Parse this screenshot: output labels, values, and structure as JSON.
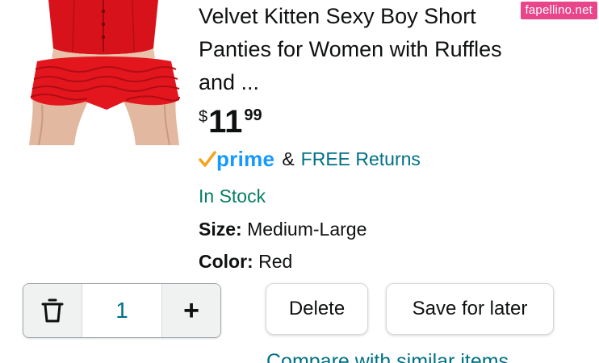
{
  "product": {
    "title_line1": "Velvet Kitten Sexy Boy Short",
    "title_line2": "Panties for Women with Ruffles",
    "title_line3": "and ...",
    "price": {
      "currency": "$",
      "whole": "11",
      "fraction": "99"
    },
    "prime_label": "prime",
    "ampersand": "&",
    "free_returns": "FREE Returns",
    "stock_status": "In Stock",
    "size_label": "Size:",
    "size_value": "Medium-Large",
    "color_label": "Color:",
    "color_value": "Red"
  },
  "cart_controls": {
    "quantity": "1",
    "delete_label": "Delete",
    "save_for_later_label": "Save for later",
    "compare_label": "Compare with similar items",
    "icons": {
      "trash": "trash-icon",
      "plus": "plus-icon"
    }
  },
  "watermark": "fapellino.net",
  "colors": {
    "link_teal": "#007185",
    "stock_green": "#067d62",
    "prime_blue": "#1399ff",
    "prime_orange": "#f7a31c",
    "button_border": "#d5d9d9",
    "watermark_pink": "#e8458b"
  }
}
